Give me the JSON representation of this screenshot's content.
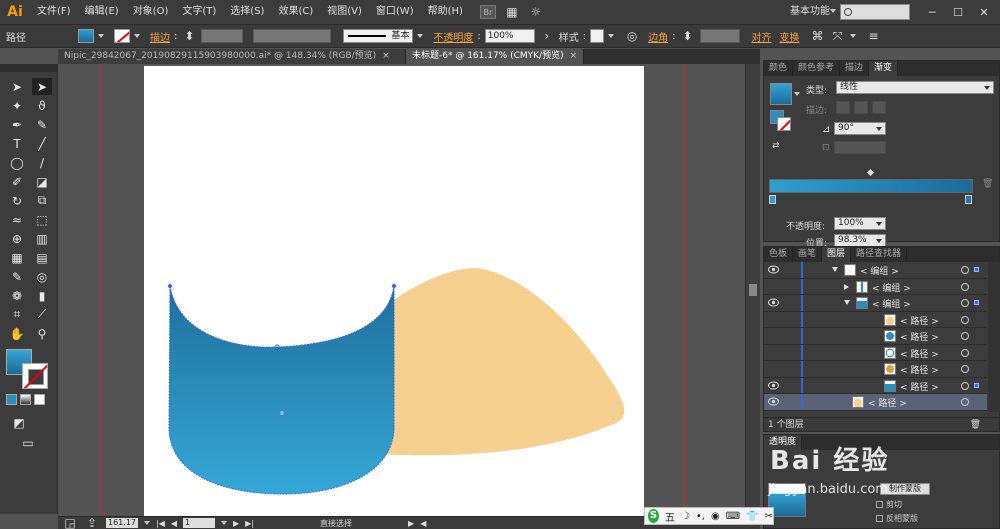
{
  "app": {
    "logo": "Ai"
  },
  "menu": [
    "文件(F)",
    "编辑(E)",
    "对象(O)",
    "文字(T)",
    "选择(S)",
    "效果(C)",
    "视图(V)",
    "窗口(W)",
    "帮助(H)"
  ],
  "menu_icons": {
    "bridge": "Br",
    "arrange": "▦",
    "gpu": "☼"
  },
  "workspace": "基本功能",
  "control": {
    "object_type": "路径",
    "stroke_label": "描边",
    "stroke_style_label": "基本",
    "opacity_label": "不透明度",
    "opacity_value": "100%",
    "style_label": "样式",
    "corner_label": "边角",
    "align_label": "对齐",
    "transform_label": "变换"
  },
  "tabs": [
    {
      "label": "Nipic_29842067_20190829115903980000.ai* @ 148.34% (RGB/预览)",
      "close": "×"
    },
    {
      "label": "未标题-6* @ 161.17% (CMYK/预览)",
      "close": "×"
    }
  ],
  "tools": [
    {
      "name": "selection-tool-icon",
      "glyph": "➤"
    },
    {
      "name": "direct-selection-tool-icon",
      "glyph": "➤"
    },
    {
      "name": "magic-wand-tool-icon",
      "glyph": "✦"
    },
    {
      "name": "lasso-tool-icon",
      "glyph": "ϑ"
    },
    {
      "name": "pen-tool-icon",
      "glyph": "✒"
    },
    {
      "name": "curvature-tool-icon",
      "glyph": "✎"
    },
    {
      "name": "type-tool-icon",
      "glyph": "T"
    },
    {
      "name": "line-tool-icon",
      "glyph": "╱"
    },
    {
      "name": "ellipse-tool-icon",
      "glyph": "◯"
    },
    {
      "name": "paintbrush-tool-icon",
      "glyph": "∕"
    },
    {
      "name": "pencil-tool-icon",
      "glyph": "✐"
    },
    {
      "name": "eraser-tool-icon",
      "glyph": "◪"
    },
    {
      "name": "rotate-tool-icon",
      "glyph": "↻"
    },
    {
      "name": "scale-tool-icon",
      "glyph": "⧉"
    },
    {
      "name": "warp-tool-icon",
      "glyph": "≈"
    },
    {
      "name": "free-transform-tool-icon",
      "glyph": "⬚"
    },
    {
      "name": "shape-builder-tool-icon",
      "glyph": "⊕"
    },
    {
      "name": "perspective-grid-tool-icon",
      "glyph": "▥"
    },
    {
      "name": "mesh-tool-icon",
      "glyph": "▦"
    },
    {
      "name": "gradient-tool-icon",
      "glyph": "▤"
    },
    {
      "name": "eyedropper-tool-icon",
      "glyph": "✎"
    },
    {
      "name": "blend-tool-icon",
      "glyph": "◎"
    },
    {
      "name": "symbol-sprayer-tool-icon",
      "glyph": "❁"
    },
    {
      "name": "column-graph-tool-icon",
      "glyph": "▮"
    },
    {
      "name": "artboard-tool-icon",
      "glyph": "⌗"
    },
    {
      "name": "slice-tool-icon",
      "glyph": "⟋"
    },
    {
      "name": "hand-tool-icon",
      "glyph": "✋"
    },
    {
      "name": "zoom-tool-icon",
      "glyph": "⚲"
    }
  ],
  "gradient_panel": {
    "tabs": [
      "颜色",
      "颜色参考",
      "描边",
      "渐变"
    ],
    "type_label": "类型",
    "type_value": "线性",
    "stroke_label": "描边",
    "angle_value": "90°",
    "opacity_label": "不透明度",
    "opacity_value": "100%",
    "location_label": "位置",
    "location_value": "98.3%",
    "start_color": "#2f9fd0",
    "end_color": "#1c6b98"
  },
  "layers_panel": {
    "tabs": [
      "色板",
      "画笔",
      "图层",
      "路径查找器"
    ],
    "rows": [
      {
        "indent": 80,
        "toggle": "down",
        "name": "< 编组 >",
        "eye": true,
        "thumb": "group",
        "sel": true
      },
      {
        "indent": 92,
        "toggle": "right",
        "name": "< 编组 >",
        "eye": false,
        "thumb": "small",
        "sel": false
      },
      {
        "indent": 92,
        "toggle": "down",
        "name": "< 编组 >",
        "eye": true,
        "thumb": "cup",
        "sel": true
      },
      {
        "indent": 120,
        "toggle": "",
        "name": "< 路径 >",
        "eye": false,
        "thumb": "tan",
        "sel": false
      },
      {
        "indent": 120,
        "toggle": "",
        "name": "< 路径 >",
        "eye": false,
        "thumb": "blue-ellipse",
        "sel": false
      },
      {
        "indent": 120,
        "toggle": "",
        "name": "< 路径 >",
        "eye": false,
        "thumb": "white-ellipse",
        "sel": false
      },
      {
        "indent": 120,
        "toggle": "",
        "name": "< 路径 >",
        "eye": false,
        "thumb": "gold",
        "sel": false
      },
      {
        "indent": 120,
        "toggle": "",
        "name": "< 路径 >",
        "eye": true,
        "thumb": "cup",
        "sel": true
      },
      {
        "indent": 88,
        "toggle": "",
        "name": "< 路径 >",
        "eye": true,
        "thumb": "tan",
        "sel": false,
        "selected": true
      }
    ],
    "footer": "1 个图层"
  },
  "transparency_panel": {
    "tab": "透明度",
    "make_mask": "制作蒙版",
    "clip": "剪切",
    "invert": "反相蒙版"
  },
  "status": {
    "zoom": "161.17",
    "page": "1",
    "tool": "直接选择"
  },
  "watermark": {
    "brand": "Bai 经验",
    "url": "jingyan.baidu.com"
  },
  "ime": {
    "logo": "S",
    "mode": "五"
  },
  "colors": {
    "cup_top": "#1f6f9c",
    "cup_bottom": "#35a8d8",
    "sand": "#f5d08e",
    "guide": "#c62828"
  }
}
